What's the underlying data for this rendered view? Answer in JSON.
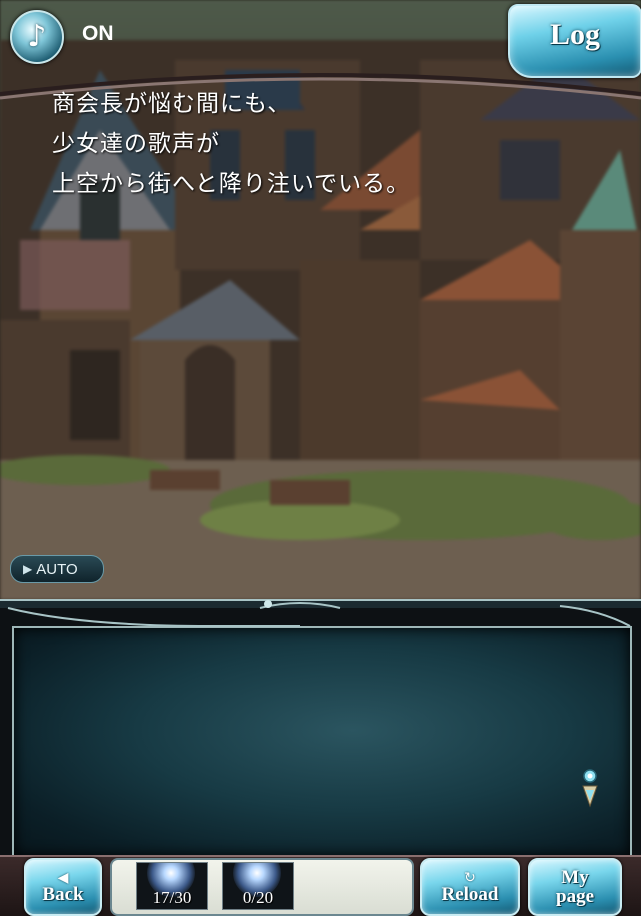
{
  "top_bar": {
    "sound_toggle": {
      "icon": "music-note-icon",
      "label": "ON"
    },
    "log_button": {
      "label": "Log"
    }
  },
  "auto_button": {
    "icon": "play-triangle-icon",
    "label": "AUTO"
  },
  "dialogue": {
    "lines": [
      "商会長が悩む間にも、",
      "少女達の歌声が",
      "上空から街へと降り注いでいる。"
    ],
    "next_icon": "next-page-icon"
  },
  "bottom_bar": {
    "back": {
      "icon": "arrow-left-icon",
      "label": "Back"
    },
    "items": [
      {
        "icon": "item-orb-icon",
        "count": "17/30"
      },
      {
        "icon": "item-orb-icon",
        "count": "0/20"
      }
    ],
    "reload": {
      "icon": "reload-icon",
      "label": "Reload"
    },
    "mypage": {
      "label_line1": "My",
      "label_line2": "page"
    }
  },
  "colors": {
    "accent": "#79d6ec",
    "frame": "#9eb7b8",
    "text": "#ffffff"
  }
}
